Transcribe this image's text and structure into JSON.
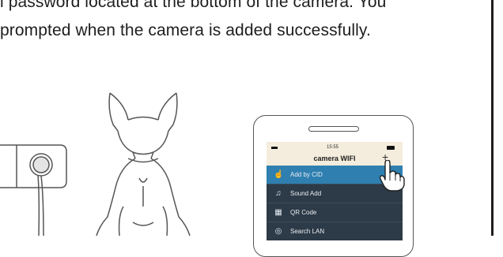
{
  "instructions": {
    "line1": "l password located at the bottom of the camera. You",
    "line2": "prompted when the camera is added successfully."
  },
  "phone": {
    "status_time": "15:55",
    "title": "camera WIFI",
    "add_icon": "+",
    "menu": [
      {
        "icon": "hand-pointer-icon",
        "glyph": "☝",
        "label": "Add by CID",
        "active": true
      },
      {
        "icon": "sound-wave-icon",
        "glyph": "♫",
        "label": "Sound Add",
        "active": false
      },
      {
        "icon": "qr-code-icon",
        "glyph": "▦",
        "label": "QR Code",
        "active": false
      },
      {
        "icon": "search-lan-icon",
        "glyph": "◎",
        "label": "Search LAN",
        "active": false
      }
    ]
  },
  "colors": {
    "screen_bg": "#2d3a47",
    "active_item": "#2f7fb0",
    "status_bar": "#f4eddd"
  }
}
